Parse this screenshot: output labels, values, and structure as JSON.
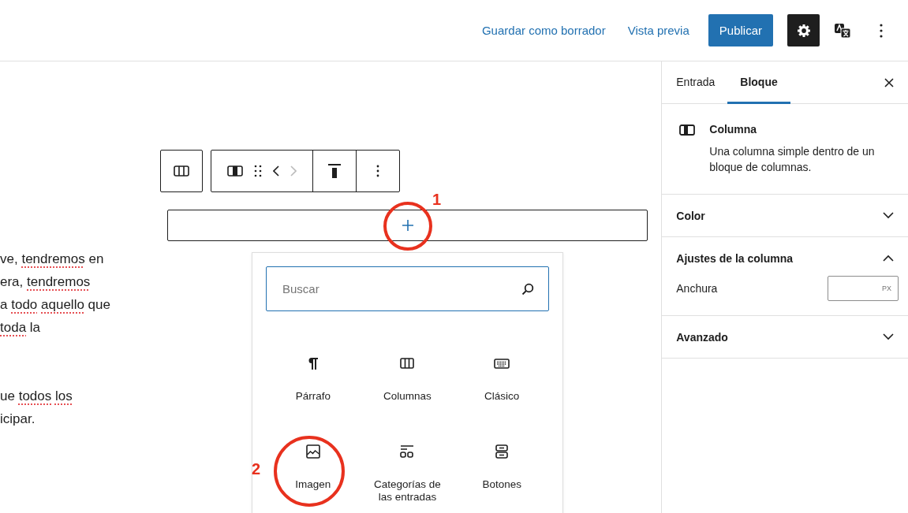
{
  "header": {
    "actions": [
      {
        "label": "Guardar como borrador",
        "kind": "link"
      },
      {
        "label": "Vista previa",
        "kind": "link"
      },
      {
        "label": "Publicar",
        "kind": "primary"
      }
    ],
    "settings_toggle": {
      "selected": true
    }
  },
  "toolbar": {
    "move_left": {
      "disabled": false
    },
    "move_right": {
      "disabled": true
    }
  },
  "content": {
    "paragraphs": [
      [
        [
          {
            "text": "ve,",
            "flagged": false
          },
          {
            "text": "tendremos",
            "flagged": true
          },
          {
            "text": "en",
            "flagged": false
          }
        ],
        [
          {
            "text": "era,",
            "flagged": false
          },
          {
            "text": "tendremos",
            "flagged": true
          }
        ],
        [
          {
            "text": "a",
            "flagged": false
          },
          {
            "text": "todo",
            "flagged": true
          },
          {
            "text": "aquello",
            "flagged": true
          },
          {
            "text": "que",
            "flagged": false
          }
        ],
        [
          {
            "text": "toda",
            "flagged": true
          },
          {
            "text": "la",
            "flagged": false
          }
        ]
      ],
      [
        [
          {
            "text": "ue",
            "flagged": false
          },
          {
            "text": "todos",
            "flagged": true
          },
          {
            "text": "los",
            "flagged": true
          }
        ],
        [
          {
            "text": "icipar.",
            "flagged": false
          }
        ]
      ]
    ]
  },
  "inserter": {
    "search": {
      "placeholder": "Buscar"
    },
    "blocks": [
      {
        "label": "Párrafo",
        "kind": "paragraph"
      },
      {
        "label": "Columnas",
        "kind": "columns"
      },
      {
        "label": "Clásico",
        "kind": "classic"
      },
      {
        "label": "Imagen",
        "kind": "image"
      },
      {
        "label": "Categorías de las entradas",
        "kind": "categories"
      },
      {
        "label": "Botones",
        "kind": "buttons"
      }
    ]
  },
  "sidebar": {
    "tabs": [
      {
        "label": "Entrada",
        "selected": false
      },
      {
        "label": "Bloque",
        "selected": true
      }
    ],
    "block": {
      "title": "Columna",
      "description": "Una columna simple dentro de un bloque de columnas."
    },
    "panels": [
      {
        "title": "Color",
        "expanded": false
      },
      {
        "title": "Ajustes de la columna",
        "expanded": true,
        "fields": [
          {
            "label": "Anchura",
            "unit": "PX"
          }
        ]
      },
      {
        "title": "Avanzado",
        "expanded": false
      }
    ]
  },
  "annotations": [
    {
      "label": "1"
    },
    {
      "label": "2"
    }
  ]
}
